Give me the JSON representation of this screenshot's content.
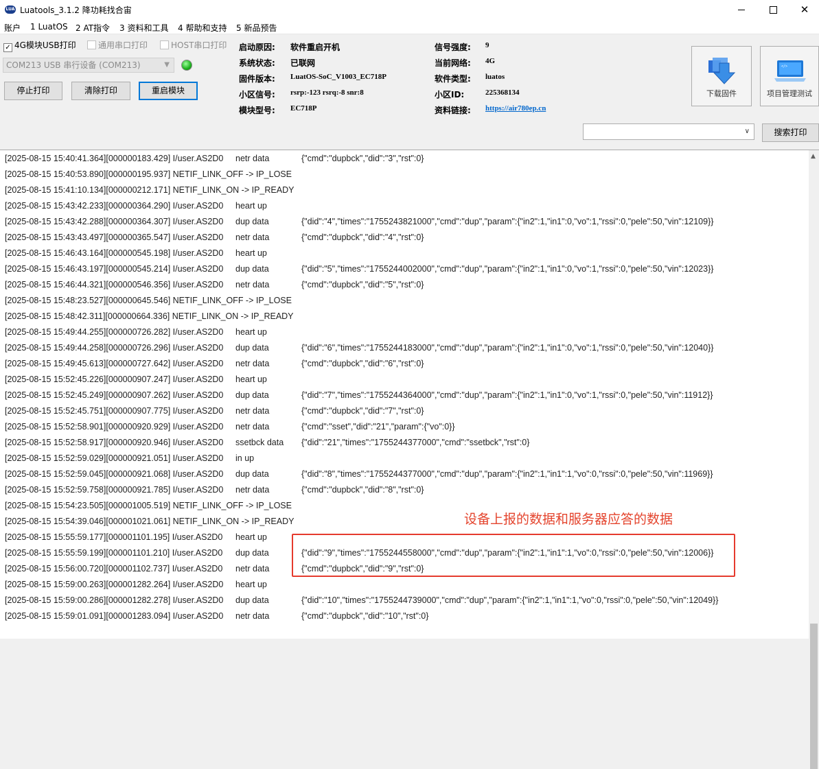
{
  "window": {
    "title": "Luatools_3.1.2 降功耗找合宙",
    "icon_text": "LUA"
  },
  "menu": [
    "账户",
    "1 LuatOS",
    "2 AT指令",
    "3 资料和工具",
    "4 帮助和支持",
    "5 新品预告"
  ],
  "options": {
    "usb_print": "4G模块USB打印",
    "serial_print": "通用串口打印",
    "host_print": "HOST串口打印"
  },
  "port": {
    "selected": "COM213 USB 串行设备 (COM213)"
  },
  "buttons": {
    "stop_print": "停止打印",
    "clear_print": "清除打印",
    "restart_module": "重启模块"
  },
  "info": {
    "boot_reason_label": "启动原因:",
    "boot_reason": "软件重启开机",
    "system_status_label": "系统状态:",
    "system_status": "已联网",
    "firmware_label": "固件版本:",
    "firmware": "LuatOS-SoC_V1003_EC718P",
    "cell_signal_label": "小区信号:",
    "cell_signal": "rsrp:-123 rsrq:-8 snr:8",
    "module_model_label": "模块型号:",
    "module_model": "EC718P",
    "signal_strength_label": "信号强度:",
    "signal_strength": "9",
    "network_label": "当前网络:",
    "network": "4G",
    "software_type_label": "软件类型:",
    "software_type": "luatos",
    "cell_id_label": "小区ID:",
    "cell_id": "225368134",
    "link_label": "资料链接:",
    "link": "https://air780ep.cn"
  },
  "tools": {
    "download_firmware": "下载固件",
    "project_test": "项目管理测试"
  },
  "search": {
    "value": "",
    "button": "搜索打印"
  },
  "log": [
    {
      "ts": "[2025-08-15 15:40:41.364][000000183.429] I/user.AS2D0",
      "tag": "netr data",
      "payload": "{\"cmd\":\"dupbck\",\"did\":\"3\",\"rst\":0}"
    },
    {
      "ts": "[2025-08-15 15:40:53.890][000000195.937] NETIF_LINK_OFF -> IP_LOSE",
      "tag": "",
      "payload": ""
    },
    {
      "ts": "[2025-08-15 15:41:10.134][000000212.171] NETIF_LINK_ON -> IP_READY",
      "tag": "",
      "payload": ""
    },
    {
      "ts": "[2025-08-15 15:43:42.233][000000364.290] I/user.AS2D0",
      "tag": "heart up",
      "payload": ""
    },
    {
      "ts": "[2025-08-15 15:43:42.288][000000364.307] I/user.AS2D0",
      "tag": "dup data",
      "payload": "{\"did\":\"4\",\"times\":\"1755243821000\",\"cmd\":\"dup\",\"param\":{\"in2\":1,\"in1\":0,\"vo\":1,\"rssi\":0,\"pele\":50,\"vin\":12109}}"
    },
    {
      "ts": "[2025-08-15 15:43:43.497][000000365.547] I/user.AS2D0",
      "tag": "netr data",
      "payload": "{\"cmd\":\"dupbck\",\"did\":\"4\",\"rst\":0}"
    },
    {
      "ts": "[2025-08-15 15:46:43.164][000000545.198] I/user.AS2D0",
      "tag": "heart up",
      "payload": ""
    },
    {
      "ts": "[2025-08-15 15:46:43.197][000000545.214] I/user.AS2D0",
      "tag": "dup data",
      "payload": "{\"did\":\"5\",\"times\":\"1755244002000\",\"cmd\":\"dup\",\"param\":{\"in2\":1,\"in1\":0,\"vo\":1,\"rssi\":0,\"pele\":50,\"vin\":12023}}"
    },
    {
      "ts": "[2025-08-15 15:46:44.321][000000546.356] I/user.AS2D0",
      "tag": "netr data",
      "payload": "{\"cmd\":\"dupbck\",\"did\":\"5\",\"rst\":0}"
    },
    {
      "ts": "[2025-08-15 15:48:23.527][000000645.546] NETIF_LINK_OFF -> IP_LOSE",
      "tag": "",
      "payload": ""
    },
    {
      "ts": "[2025-08-15 15:48:42.311][000000664.336] NETIF_LINK_ON -> IP_READY",
      "tag": "",
      "payload": ""
    },
    {
      "ts": "[2025-08-15 15:49:44.255][000000726.282] I/user.AS2D0",
      "tag": "heart up",
      "payload": ""
    },
    {
      "ts": "[2025-08-15 15:49:44.258][000000726.296] I/user.AS2D0",
      "tag": "dup data",
      "payload": "{\"did\":\"6\",\"times\":\"1755244183000\",\"cmd\":\"dup\",\"param\":{\"in2\":1,\"in1\":0,\"vo\":1,\"rssi\":0,\"pele\":50,\"vin\":12040}}"
    },
    {
      "ts": "[2025-08-15 15:49:45.613][000000727.642] I/user.AS2D0",
      "tag": "netr data",
      "payload": "{\"cmd\":\"dupbck\",\"did\":\"6\",\"rst\":0}"
    },
    {
      "ts": "[2025-08-15 15:52:45.226][000000907.247] I/user.AS2D0",
      "tag": "heart up",
      "payload": ""
    },
    {
      "ts": "[2025-08-15 15:52:45.249][000000907.262] I/user.AS2D0",
      "tag": "dup data",
      "payload": "{\"did\":\"7\",\"times\":\"1755244364000\",\"cmd\":\"dup\",\"param\":{\"in2\":1,\"in1\":0,\"vo\":1,\"rssi\":0,\"pele\":50,\"vin\":11912}}"
    },
    {
      "ts": "[2025-08-15 15:52:45.751][000000907.775] I/user.AS2D0",
      "tag": "netr data",
      "payload": "{\"cmd\":\"dupbck\",\"did\":\"7\",\"rst\":0}"
    },
    {
      "ts": "[2025-08-15 15:52:58.901][000000920.929] I/user.AS2D0",
      "tag": "netr data",
      "payload": "{\"cmd\":\"sset\",\"did\":\"21\",\"param\":{\"vo\":0}}"
    },
    {
      "ts": "[2025-08-15 15:52:58.917][000000920.946] I/user.AS2D0",
      "tag": "ssetbck data",
      "payload": "{\"did\":\"21\",\"times\":\"1755244377000\",\"cmd\":\"ssetbck\",\"rst\":0}"
    },
    {
      "ts": "[2025-08-15 15:52:59.029][000000921.051] I/user.AS2D0",
      "tag": "in up",
      "payload": ""
    },
    {
      "ts": "[2025-08-15 15:52:59.045][000000921.068] I/user.AS2D0",
      "tag": "dup data",
      "payload": "{\"did\":\"8\",\"times\":\"1755244377000\",\"cmd\":\"dup\",\"param\":{\"in2\":1,\"in1\":1,\"vo\":0,\"rssi\":0,\"pele\":50,\"vin\":11969}}"
    },
    {
      "ts": "[2025-08-15 15:52:59.758][000000921.785] I/user.AS2D0",
      "tag": "netr data",
      "payload": "{\"cmd\":\"dupbck\",\"did\":\"8\",\"rst\":0}"
    },
    {
      "ts": "[2025-08-15 15:54:23.505][000001005.519] NETIF_LINK_OFF -> IP_LOSE",
      "tag": "",
      "payload": ""
    },
    {
      "ts": "[2025-08-15 15:54:39.046][000001021.061] NETIF_LINK_ON -> IP_READY",
      "tag": "",
      "payload": ""
    },
    {
      "ts": "[2025-08-15 15:55:59.177][000001101.195] I/user.AS2D0",
      "tag": "heart up",
      "payload": ""
    },
    {
      "ts": "[2025-08-15 15:55:59.199][000001101.210] I/user.AS2D0",
      "tag": "dup data",
      "payload": "{\"did\":\"9\",\"times\":\"1755244558000\",\"cmd\":\"dup\",\"param\":{\"in2\":1,\"in1\":1,\"vo\":0,\"rssi\":0,\"pele\":50,\"vin\":12006}}"
    },
    {
      "ts": "[2025-08-15 15:56:00.720][000001102.737] I/user.AS2D0",
      "tag": "netr data",
      "payload": "{\"cmd\":\"dupbck\",\"did\":\"9\",\"rst\":0}"
    },
    {
      "ts": "[2025-08-15 15:59:00.263][000001282.264] I/user.AS2D0",
      "tag": "heart up",
      "payload": ""
    },
    {
      "ts": "[2025-08-15 15:59:00.286][000001282.278] I/user.AS2D0",
      "tag": "dup data",
      "payload": "{\"did\":\"10\",\"times\":\"1755244739000\",\"cmd\":\"dup\",\"param\":{\"in2\":1,\"in1\":1,\"vo\":0,\"rssi\":0,\"pele\":50,\"vin\":12049}}"
    },
    {
      "ts": "[2025-08-15 15:59:01.091][000001283.094] I/user.AS2D0",
      "tag": "netr data",
      "payload": "{\"cmd\":\"dupbck\",\"did\":\"10\",\"rst\":0}"
    }
  ],
  "annotation": {
    "text": "设备上报的数据和服务器应答的数据",
    "color": "#e53a2d"
  },
  "colors": {
    "accent": "#0078d7",
    "link": "#0066cc",
    "status_led": "#1db01d"
  }
}
